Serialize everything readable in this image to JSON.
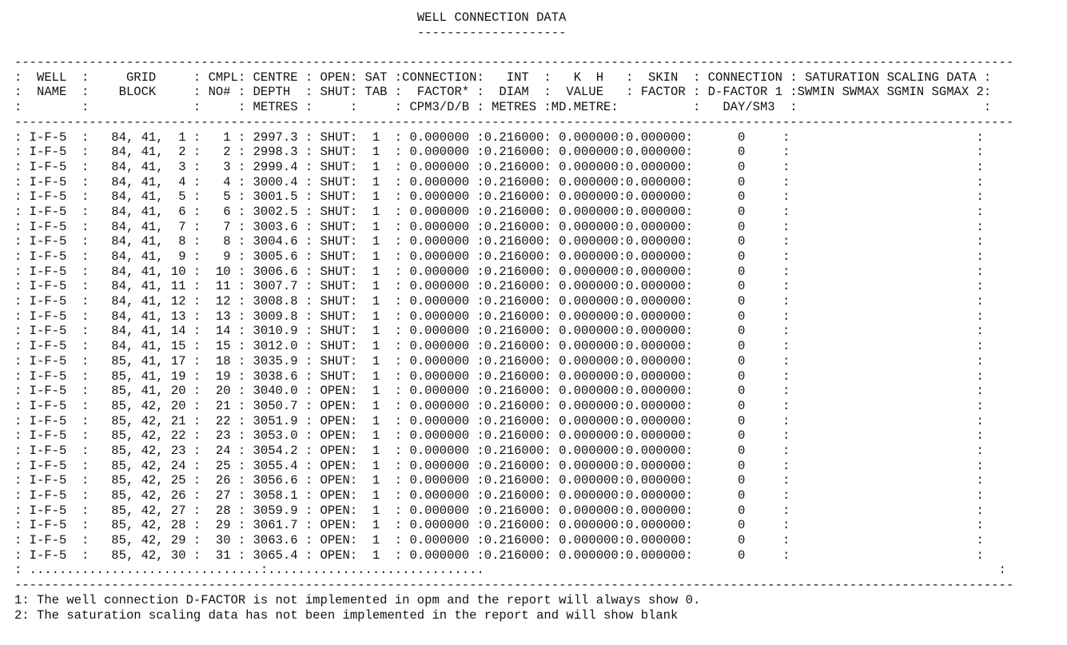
{
  "title": "WELL CONNECTION DATA",
  "title_underline": "--------------------",
  "separator": "--------------------------------------------------------------------------------------------------------------------------------------",
  "header_lines": [
    ":  WELL  :     GRID     : CMPL: CENTRE : OPEN: SAT :CONNECTION:   INT  :   K  H   :  SKIN  : CONNECTION : SATURATION SCALING DATA :",
    ":  NAME  :    BLOCK     : NO# : DEPTH  : SHUT: TAB :  FACTOR* :  DIAM  :  VALUE   : FACTOR : D-FACTOR 1 :SWMIN SWMAX SGMIN SGMAX 2:",
    ":        :              :     : METRES :     :     : CPM3/D/B : METRES :MD.METRE:          :   DAY/SM3  :                         :"
  ],
  "rows": [
    ": I-F-5  :   84, 41,  1 :   1 : 2997.3 : SHUT:  1  : 0.000000 :0.216000: 0.000000:0.000000:      0     :                         :",
    ": I-F-5  :   84, 41,  2 :   2 : 2998.3 : SHUT:  1  : 0.000000 :0.216000: 0.000000:0.000000:      0     :                         :",
    ": I-F-5  :   84, 41,  3 :   3 : 2999.4 : SHUT:  1  : 0.000000 :0.216000: 0.000000:0.000000:      0     :                         :",
    ": I-F-5  :   84, 41,  4 :   4 : 3000.4 : SHUT:  1  : 0.000000 :0.216000: 0.000000:0.000000:      0     :                         :",
    ": I-F-5  :   84, 41,  5 :   5 : 3001.5 : SHUT:  1  : 0.000000 :0.216000: 0.000000:0.000000:      0     :                         :",
    ": I-F-5  :   84, 41,  6 :   6 : 3002.5 : SHUT:  1  : 0.000000 :0.216000: 0.000000:0.000000:      0     :                         :",
    ": I-F-5  :   84, 41,  7 :   7 : 3003.6 : SHUT:  1  : 0.000000 :0.216000: 0.000000:0.000000:      0     :                         :",
    ": I-F-5  :   84, 41,  8 :   8 : 3004.6 : SHUT:  1  : 0.000000 :0.216000: 0.000000:0.000000:      0     :                         :",
    ": I-F-5  :   84, 41,  9 :   9 : 3005.6 : SHUT:  1  : 0.000000 :0.216000: 0.000000:0.000000:      0     :                         :",
    ": I-F-5  :   84, 41, 10 :  10 : 3006.6 : SHUT:  1  : 0.000000 :0.216000: 0.000000:0.000000:      0     :                         :",
    ": I-F-5  :   84, 41, 11 :  11 : 3007.7 : SHUT:  1  : 0.000000 :0.216000: 0.000000:0.000000:      0     :                         :",
    ": I-F-5  :   84, 41, 12 :  12 : 3008.8 : SHUT:  1  : 0.000000 :0.216000: 0.000000:0.000000:      0     :                         :",
    ": I-F-5  :   84, 41, 13 :  13 : 3009.8 : SHUT:  1  : 0.000000 :0.216000: 0.000000:0.000000:      0     :                         :",
    ": I-F-5  :   84, 41, 14 :  14 : 3010.9 : SHUT:  1  : 0.000000 :0.216000: 0.000000:0.000000:      0     :                         :",
    ": I-F-5  :   84, 41, 15 :  15 : 3012.0 : SHUT:  1  : 0.000000 :0.216000: 0.000000:0.000000:      0     :                         :",
    ": I-F-5  :   85, 41, 17 :  18 : 3035.9 : SHUT:  1  : 0.000000 :0.216000: 0.000000:0.000000:      0     :                         :",
    ": I-F-5  :   85, 41, 19 :  19 : 3038.6 : SHUT:  1  : 0.000000 :0.216000: 0.000000:0.000000:      0     :                         :",
    ": I-F-5  :   85, 41, 20 :  20 : 3040.0 : OPEN:  1  : 0.000000 :0.216000: 0.000000:0.000000:      0     :                         :",
    ": I-F-5  :   85, 42, 20 :  21 : 3050.7 : OPEN:  1  : 0.000000 :0.216000: 0.000000:0.000000:      0     :                         :",
    ": I-F-5  :   85, 42, 21 :  22 : 3051.9 : OPEN:  1  : 0.000000 :0.216000: 0.000000:0.000000:      0     :                         :",
    ": I-F-5  :   85, 42, 22 :  23 : 3053.0 : OPEN:  1  : 0.000000 :0.216000: 0.000000:0.000000:      0     :                         :",
    ": I-F-5  :   85, 42, 23 :  24 : 3054.2 : OPEN:  1  : 0.000000 :0.216000: 0.000000:0.000000:      0     :                         :",
    ": I-F-5  :   85, 42, 24 :  25 : 3055.4 : OPEN:  1  : 0.000000 :0.216000: 0.000000:0.000000:      0     :                         :",
    ": I-F-5  :   85, 42, 25 :  26 : 3056.6 : OPEN:  1  : 0.000000 :0.216000: 0.000000:0.000000:      0     :                         :",
    ": I-F-5  :   85, 42, 26 :  27 : 3058.1 : OPEN:  1  : 0.000000 :0.216000: 0.000000:0.000000:      0     :                         :",
    ": I-F-5  :   85, 42, 27 :  28 : 3059.9 : OPEN:  1  : 0.000000 :0.216000: 0.000000:0.000000:      0     :                         :",
    ": I-F-5  :   85, 42, 28 :  29 : 3061.7 : OPEN:  1  : 0.000000 :0.216000: 0.000000:0.000000:      0     :                         :",
    ": I-F-5  :   85, 42, 29 :  30 : 3063.6 : OPEN:  1  : 0.000000 :0.216000: 0.000000:0.000000:      0     :                         :",
    ": I-F-5  :   85, 42, 30 :  31 : 3065.4 : OPEN:  1  : 0.000000 :0.216000: 0.000000:0.000000:      0     :                         :"
  ],
  "ellipsis_line": ": ...............................:.............................                                                                     :",
  "footnotes": [
    "1: The well connection D-FACTOR is not implemented in opm and the report will always show 0.",
    "2: The saturation scaling data has not been implemented in the report and will show blank"
  ]
}
